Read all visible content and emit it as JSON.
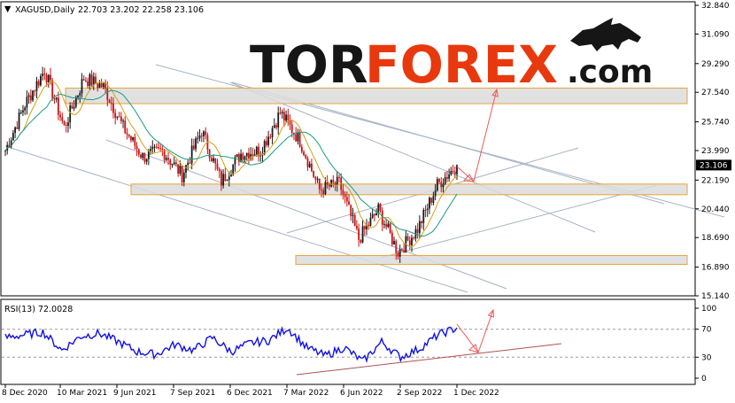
{
  "header": {
    "symbol_line": "XAGUSD,Daily",
    "ohlc": "22.703 23.202 22.258 23.106",
    "rsi_label": "RSI(13) 72.0028"
  },
  "logo": {
    "part1": "TOR",
    "part2": "FOREX",
    "part3": ".com"
  },
  "colors": {
    "bull": "#1a1a1a",
    "bear": "#cc1111",
    "ma_fast": "#d4a017",
    "ma_slow": "#1a9a82",
    "trend": "#a6b4c4",
    "zone_fill": "#dcdcdc",
    "zone_border": "#e8a33c",
    "arrow": "#f05a5a",
    "rsi": "#1010e6",
    "rsi_trend": "#b05050",
    "price_tag": "#000000"
  },
  "chart_data": [
    {
      "type": "line",
      "title": "",
      "xlabel": "",
      "ylabel": "",
      "x_ticks": [
        "8 Dec 2020",
        "10 Mar 2021",
        "9 Jun 2021",
        "7 Sep 2021",
        "6 Dec 2021",
        "7 Mar 2022",
        "6 Jun 2022",
        "2 Sep 2022",
        "1 Dec 2022"
      ],
      "y_ticks": [
        "32.840",
        "31.090",
        "29.290",
        "27.540",
        "25.740",
        "23.990",
        "22.190",
        "20.440",
        "18.690",
        "16.890",
        "15.140"
      ],
      "ylim": [
        15.14,
        32.84
      ],
      "current_price": "23.106",
      "series": [
        {
          "representation": "candlestick",
          "x": [
            "8 Dec 2020",
            "10 Mar 2021",
            "9 Jun 2021",
            "7 Sep 2021",
            "6 Dec 2021",
            "7 Mar 2022",
            "6 Jun 2022",
            "2 Sep 2022",
            "1 Dec 2022"
          ],
          "values": [
            24.8,
            25.4,
            27.9,
            24.0,
            22.6,
            25.5,
            21.3,
            19.6,
            23.1
          ]
        }
      ],
      "key_points": [
        {
          "x": "Dec 2020",
          "y": 24.0
        },
        {
          "x": "Jan 2021",
          "y": 26.8
        },
        {
          "x": "Feb 2021",
          "y": 28.9
        },
        {
          "x": "Mar 2021",
          "y": 25.4
        },
        {
          "x": "May 2021",
          "y": 28.4
        },
        {
          "x": "Jun 2021",
          "y": 27.9
        },
        {
          "x": "Jul 2021",
          "y": 25.4
        },
        {
          "x": "Aug 2021",
          "y": 23.6
        },
        {
          "x": "Sep 2021",
          "y": 24.0
        },
        {
          "x": "Oct 2021",
          "y": 22.5
        },
        {
          "x": "Nov 2021",
          "y": 25.2
        },
        {
          "x": "Dec 2021",
          "y": 22.1
        },
        {
          "x": "Jan 2022",
          "y": 23.8
        },
        {
          "x": "Feb 2022",
          "y": 24.0
        },
        {
          "x": "Mar 2022",
          "y": 26.3
        },
        {
          "x": "Apr 2022",
          "y": 24.6
        },
        {
          "x": "May 2022",
          "y": 21.6
        },
        {
          "x": "Jun 2022",
          "y": 22.0
        },
        {
          "x": "Jul 2022",
          "y": 18.6
        },
        {
          "x": "Aug 2022",
          "y": 20.4
        },
        {
          "x": "Sep 2022",
          "y": 17.8
        },
        {
          "x": "Oct 2022",
          "y": 19.2
        },
        {
          "x": "Nov 2022",
          "y": 21.9
        },
        {
          "x": "Dec 2022",
          "y": 23.1
        }
      ],
      "support_resistance_zones": [
        {
          "from": 26.85,
          "to": 27.8
        },
        {
          "from": 21.3,
          "to": 21.95
        },
        {
          "from": 17.05,
          "to": 17.6
        }
      ],
      "grid": false,
      "legend": "none"
    },
    {
      "type": "line",
      "title": "RSI(13) 72.0028",
      "y_ticks": [
        "100",
        "70",
        "30",
        "0"
      ],
      "ylim": [
        0,
        100
      ],
      "levels": [
        70,
        30
      ],
      "series": [
        {
          "name": "RSI(13)",
          "x": [
            "Dec 2020",
            "Jan 2021",
            "Feb 2021",
            "Mar 2021",
            "Apr 2021",
            "May 2021",
            "Jun 2021",
            "Jul 2021",
            "Aug 2021",
            "Sep 2021",
            "Oct 2021",
            "Nov 2021",
            "Dec 2021",
            "Jan 2022",
            "Feb 2022",
            "Mar 2022",
            "Apr 2022",
            "May 2022",
            "Jun 2022",
            "Jul 2022",
            "Aug 2022",
            "Sep 2022",
            "Oct 2022",
            "Nov 2022",
            "Dec 2022"
          ],
          "values": [
            58,
            62,
            66,
            40,
            60,
            64,
            52,
            38,
            34,
            48,
            40,
            58,
            38,
            50,
            54,
            72,
            44,
            32,
            44,
            24,
            52,
            30,
            42,
            62,
            72
          ]
        }
      ],
      "grid": false,
      "legend": "none"
    }
  ]
}
